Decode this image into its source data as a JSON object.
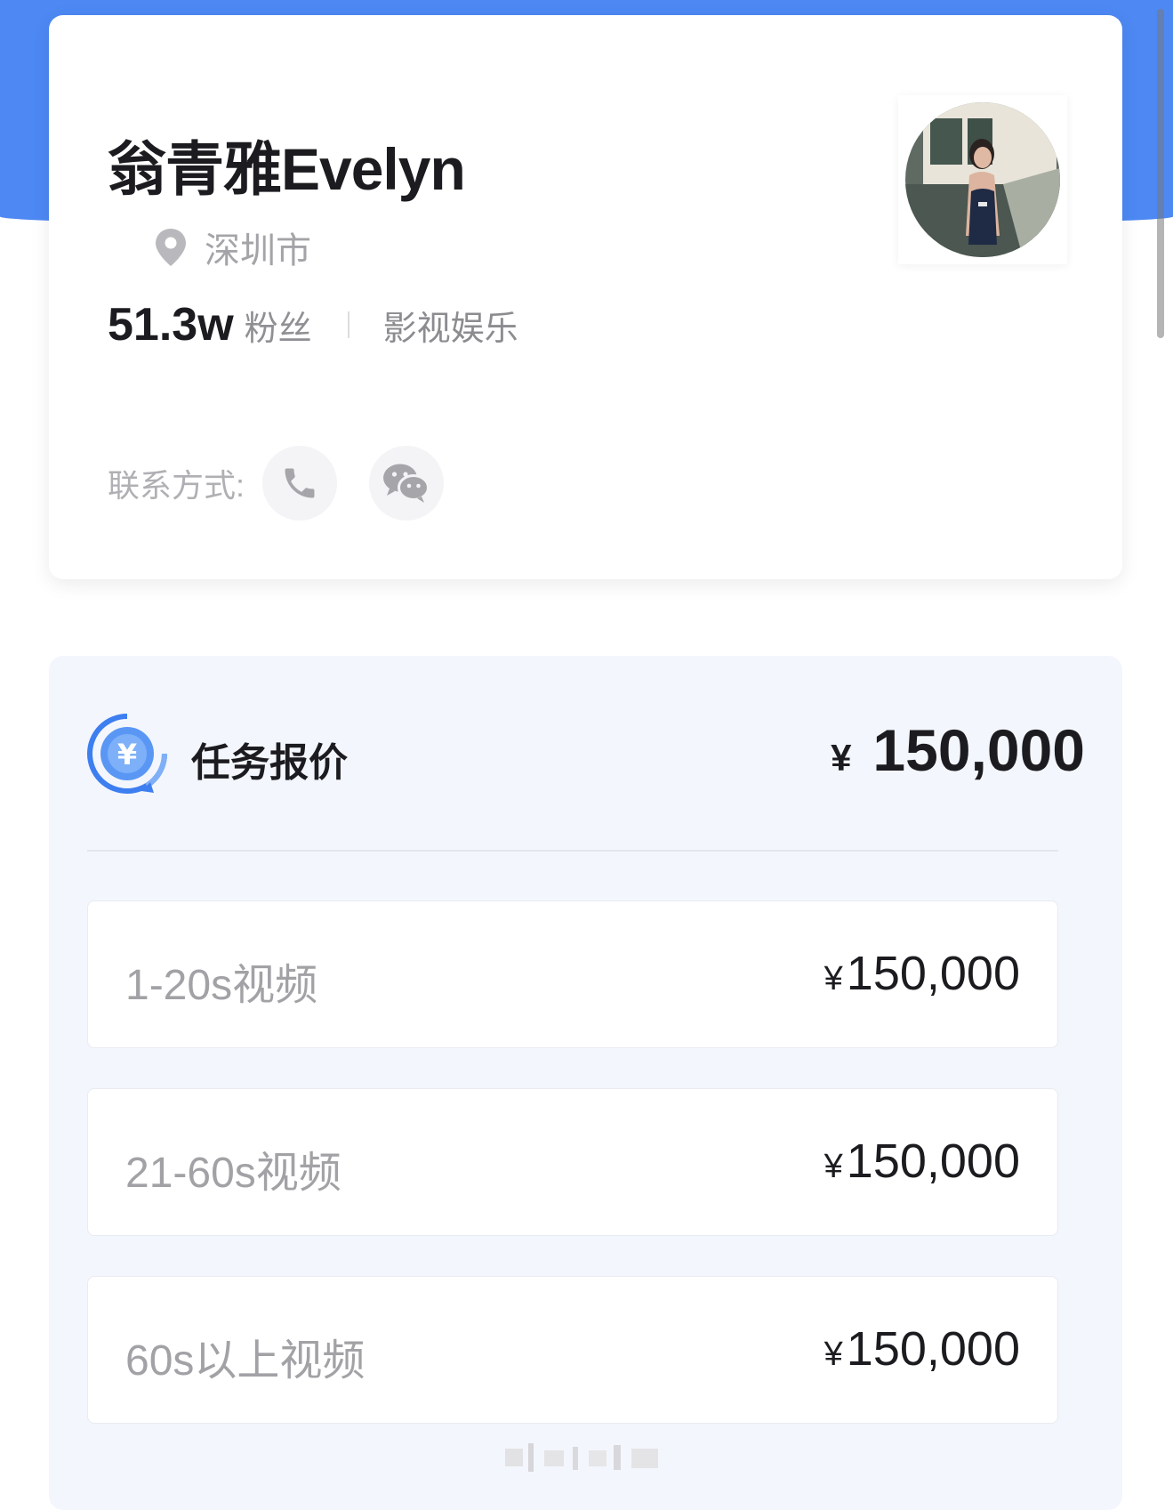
{
  "profile": {
    "name": "翁青雅Evelyn",
    "location": "深圳市",
    "fans_count": "51.3w",
    "fans_label": "粉丝",
    "category": "影视娱乐",
    "contact_label": "联系方式:"
  },
  "icons": {
    "location": "location-pin-icon",
    "phone": "phone-icon",
    "wechat": "wechat-icon",
    "price": "yuan-coin-icon"
  },
  "pricing": {
    "title": "任务报价",
    "currency": "¥",
    "total": "150,000",
    "rows": [
      {
        "label": "1-20s视频",
        "currency": "¥",
        "price": "150,000"
      },
      {
        "label": "21-60s视频",
        "currency": "¥",
        "price": "150,000"
      },
      {
        "label": "60s以上视频",
        "currency": "¥",
        "price": "150,000"
      }
    ]
  },
  "colors": {
    "accent_blue": "#4d88f3",
    "panel_background": "#f3f6fd",
    "text_primary": "#1c1c20",
    "text_secondary": "#a2a2a6"
  }
}
